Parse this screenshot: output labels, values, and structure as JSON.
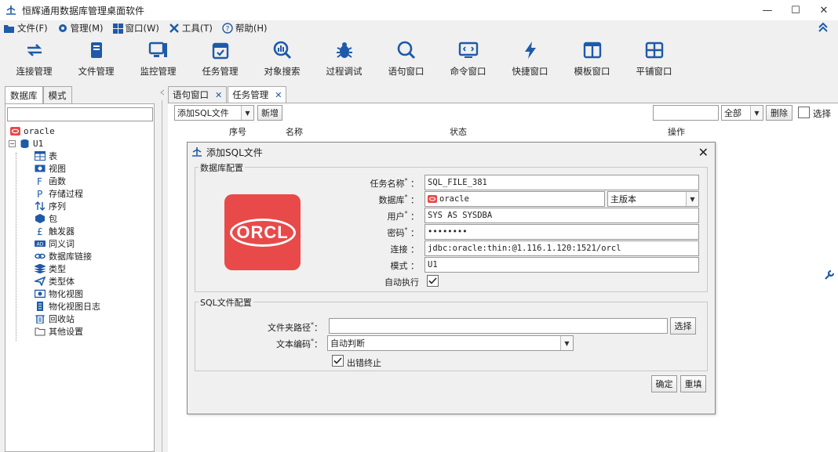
{
  "window": {
    "title": "恒辉通用数据库管理桌面软件",
    "controls": [
      "—",
      "☐",
      "✕"
    ]
  },
  "menu": [
    {
      "label": "文件(F)",
      "icon": "folder-icon"
    },
    {
      "label": "管理(M)",
      "icon": "gear-icon"
    },
    {
      "label": "窗口(W)",
      "icon": "windows-icon"
    },
    {
      "label": "工具(T)",
      "icon": "tools-icon"
    },
    {
      "label": "帮助(H)",
      "icon": "help-icon"
    }
  ],
  "toolbar": [
    {
      "label": "连接管理",
      "icon": "sync-icon"
    },
    {
      "label": "文件管理",
      "icon": "book-icon"
    },
    {
      "label": "监控管理",
      "icon": "monitor-icon"
    },
    {
      "label": "任务管理",
      "icon": "calendar-icon"
    },
    {
      "label": "对象搜索",
      "icon": "search-chart-icon"
    },
    {
      "label": "过程调试",
      "icon": "bug-icon"
    },
    {
      "label": "语句窗口",
      "icon": "search-icon"
    },
    {
      "label": "命令窗口",
      "icon": "terminal-icon"
    },
    {
      "label": "快捷窗口",
      "icon": "bolt-icon"
    },
    {
      "label": "模板窗口",
      "icon": "columns-icon"
    },
    {
      "label": "平铺窗口",
      "icon": "grid-icon"
    }
  ],
  "left_panel": {
    "tabs": [
      "数据库",
      "模式"
    ],
    "tree": {
      "root": "oracle",
      "schema": "U1",
      "items": [
        "表",
        "视图",
        "函数",
        "存储过程",
        "序列",
        "包",
        "触发器",
        "同义词",
        "数据库链接",
        "类型",
        "类型体",
        "物化视图",
        "物化视图日志",
        "回收站",
        "其他设置"
      ]
    }
  },
  "right_tabs": [
    {
      "label": "语句窗口",
      "close": "✕"
    },
    {
      "label": "任务管理",
      "close": "✕"
    }
  ],
  "task_toolbar": {
    "add_combo": "添加SQL文件",
    "new_button": "新增",
    "filter_combo": "全部",
    "delete_button": "删除",
    "select_label": "选择"
  },
  "table_headers": [
    "序号",
    "名称",
    "状态",
    "操作"
  ],
  "dialog": {
    "title": "添加SQL文件",
    "close": "✕",
    "db_group_label": "数据库配置",
    "logo_text": "ORCL",
    "fields": {
      "task_name_label": "任务名称",
      "task_name_value": "SQL_FILE_381",
      "database_label": "数据库",
      "database_value": "oracle",
      "version_value": "主版本",
      "user_label": "用户",
      "user_value": "SYS AS SYSDBA",
      "password_label": "密码",
      "password_value": "••••••••",
      "connection_label": "连接",
      "connection_value": "jdbc:oracle:thin:@1.116.1.120:1521/orcl",
      "schema_label": "模式",
      "schema_value": "U1",
      "auto_exec_label": "自动执行"
    },
    "sql_group_label": "SQL文件配置",
    "folder_label": "文件夹路径",
    "folder_value": "",
    "choose_button": "选择",
    "encoding_label": "文本编码",
    "encoding_value": "自动判断",
    "stop_on_error_label": "出错终止",
    "ok_button": "确定",
    "reset_button": "重填",
    "required_mark": "*",
    "colon": "："
  },
  "colors": {
    "accent": "#1e5aa8",
    "oracle_red": "#e84a4a"
  }
}
